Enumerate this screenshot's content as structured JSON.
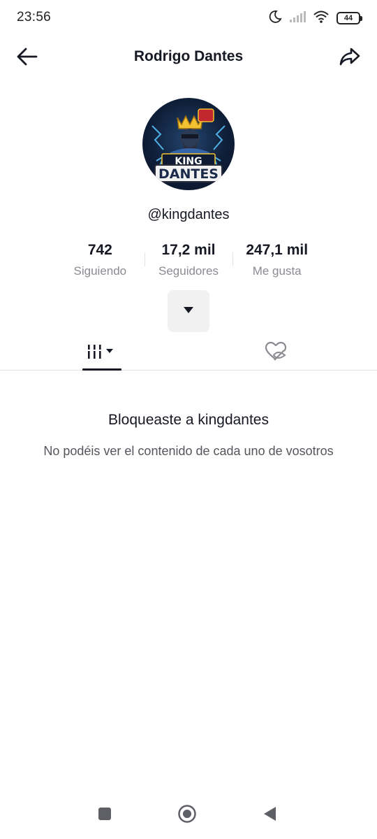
{
  "status_bar": {
    "time": "23:56",
    "battery": "44"
  },
  "header": {
    "title": "Rodrigo Dantes"
  },
  "profile": {
    "username": "@kingdantes",
    "avatar_text_top": "KING",
    "avatar_text_bottom": "DANTES",
    "stats": [
      {
        "value": "742",
        "label": "Siguiendo"
      },
      {
        "value": "17,2 mil",
        "label": "Seguidores"
      },
      {
        "value": "247,1 mil",
        "label": "Me gusta"
      }
    ]
  },
  "blocked": {
    "title": "Bloqueaste a kingdantes",
    "description": "No podéis ver el contenido de cada uno de vosotros"
  },
  "icons": {
    "back": "arrow-left-icon",
    "share": "share-arrow-icon",
    "expand": "caret-down-icon",
    "videos_tab": "grid-bars-icon",
    "liked_tab": "heart-eye-slash-icon"
  }
}
